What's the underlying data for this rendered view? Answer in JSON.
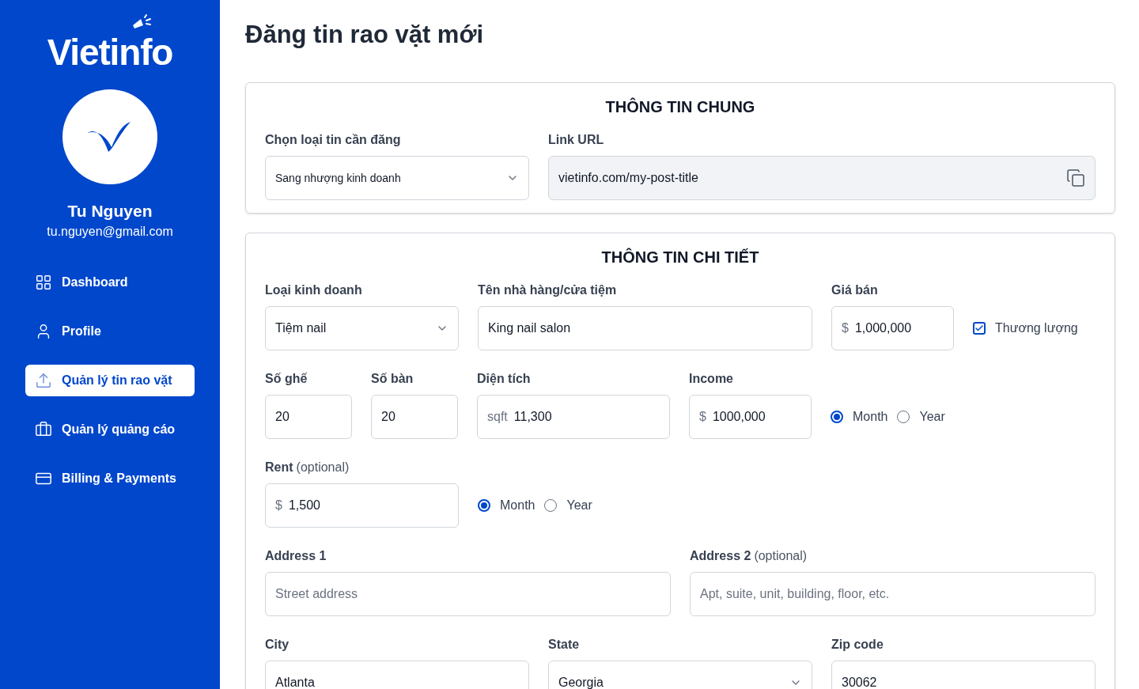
{
  "sidebar": {
    "logo": "Vietinfo",
    "user": {
      "name": "Tu Nguyen",
      "email": "tu.nguyen@gmail.com"
    },
    "nav": [
      {
        "label": "Dashboard",
        "selected": false
      },
      {
        "label": "Profile",
        "selected": false
      },
      {
        "label": "Quản lý tin rao vặt",
        "selected": true
      },
      {
        "label": "Quản lý quảng cáo",
        "selected": false
      },
      {
        "label": "Billing & Payments",
        "selected": false
      }
    ]
  },
  "page_title": "Đăng tin rao vặt mới",
  "general": {
    "title": "THÔNG TIN CHUNG",
    "post_type": {
      "label": "Chọn loại tin cần đăng",
      "value": "Sang nhượng kinh doanh"
    },
    "link_url": {
      "label": "Link URL",
      "value": "vietinfo.com/my-post-title"
    }
  },
  "details": {
    "title": "THÔNG TIN CHI TIẾT",
    "fields": [
      {
        "kind": "select",
        "label": "Loại kinh doanh",
        "value": "Tiệm nail"
      },
      {
        "kind": "text",
        "label": "Tên nhà hàng/cửa tiệm",
        "value": "King nail salon"
      },
      {
        "kind": "text",
        "label": "Giá bán",
        "prefix": "$",
        "value": "1,000,000"
      },
      {
        "kind": "checkbox",
        "label": "Thương lượng",
        "checked": true
      },
      {
        "kind": "text",
        "label": "Số ghế",
        "value": "20"
      },
      {
        "kind": "text",
        "label": "Số bàn",
        "value": "20"
      },
      {
        "kind": "text",
        "label": "Diện tích",
        "prefix": "sqft",
        "value": "11,300"
      },
      {
        "kind": "text",
        "label": "Income",
        "prefix": "$",
        "value": "1000,000"
      },
      {
        "kind": "radio",
        "options": [
          {
            "label": "Month",
            "selected": true
          },
          {
            "label": "Year",
            "selected": false
          }
        ]
      },
      {
        "kind": "text",
        "label": "Rent",
        "note": "(optional)",
        "prefix": "$",
        "value": "1,500"
      },
      {
        "kind": "radio",
        "options": [
          {
            "label": "Month",
            "selected": true
          },
          {
            "label": "Year",
            "selected": false
          }
        ]
      },
      {
        "kind": "text",
        "label": "Address 1",
        "placeholder": "Street address"
      },
      {
        "kind": "text",
        "label": "Address 2",
        "note": "(optional)",
        "placeholder": "Apt, suite, unit, building, floor, etc."
      },
      {
        "kind": "text",
        "label": "City",
        "value": "Atlanta"
      },
      {
        "kind": "select",
        "label": "State",
        "value": "Georgia"
      },
      {
        "kind": "text",
        "label": "Zip code",
        "value": "30062"
      }
    ]
  }
}
